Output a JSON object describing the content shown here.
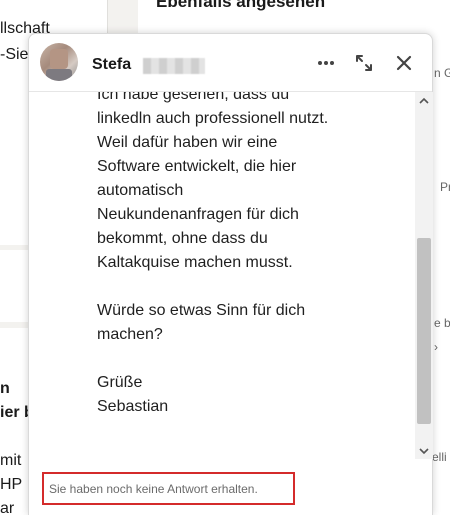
{
  "background": {
    "left_texts": [
      "llschaft",
      "-Sie"
    ],
    "right_heading": "Ebenfalls angesehen",
    "left_lower_texts": [
      "n",
      "ier b",
      "mit",
      "HP",
      "ar"
    ],
    "right_fragments": [
      "n G",
      "Pr",
      "e be",
      "elli"
    ]
  },
  "chat": {
    "contact_name": "Stefa",
    "header_icons": [
      "more-icon",
      "expand-icon",
      "close-icon"
    ],
    "message_text": "Ich habe gesehen, dass du\nlinkedln auch professionell nutzt.\nWeil dafür haben wir eine\nSoftware entwickelt, die hier\nautomatisch\nNeukundenanfragen für dich\nbekommt, ohne dass du\nKaltakquise machen musst.\n\nWürde so etwas Sinn für dich\nmachen?\n\nGrüße\nSebastian",
    "notice": "Sie haben noch keine Antwort erhalten.",
    "notice_border_color": "#d42b2b"
  }
}
